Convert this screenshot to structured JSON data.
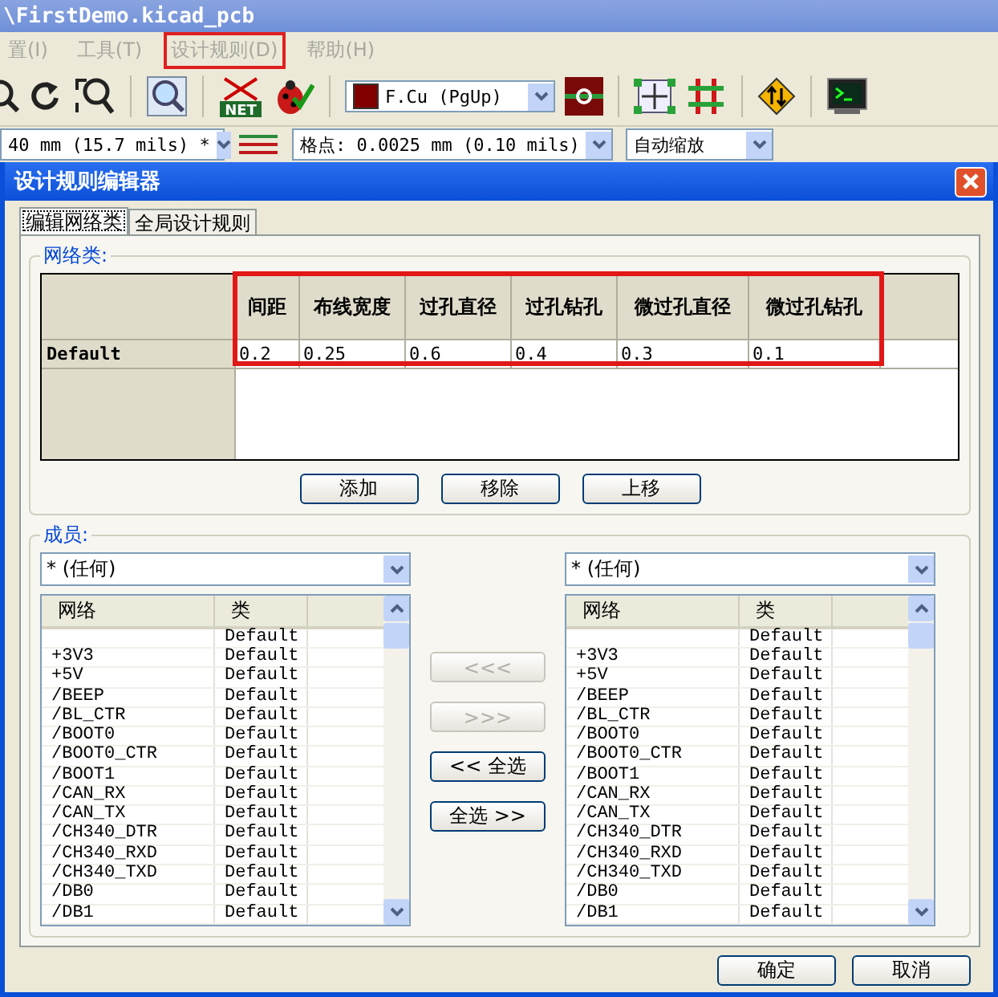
{
  "window": {
    "title": "\\FirstDemo.kicad_pcb"
  },
  "menu": [
    {
      "label": "置(I)",
      "highlighted": false
    },
    {
      "label": "工具(T)",
      "highlighted": false
    },
    {
      "label": "设计规则(D)",
      "highlighted": true
    },
    {
      "label": "帮助(H)",
      "highlighted": false
    }
  ],
  "toolbar": {
    "netlist_label": "NET",
    "layer": {
      "value": "F.Cu (PgUp)",
      "color": "#800000"
    }
  },
  "toolbar2": {
    "track_width": "40 mm (15.7 mils) *",
    "grid": "格点: 0.0025 mm (0.10 mils)",
    "zoom": "自动缩放"
  },
  "dialog": {
    "title": "设计规则编辑器",
    "tabs": [
      {
        "label": "编辑网络类",
        "selected": true
      },
      {
        "label": "全局设计规则",
        "selected": false
      }
    ],
    "net_classes": {
      "legend": "网络类:",
      "highlight_columns": true,
      "columns": [
        "间距",
        "布线宽度",
        "过孔直径",
        "过孔钻孔",
        "微过孔直径",
        "微过孔钻孔"
      ],
      "rows": [
        {
          "name": "Default",
          "cells": [
            "0.2",
            "0.25",
            "0.6",
            "0.4",
            "0.3",
            "0.1"
          ]
        }
      ],
      "buttons": [
        "添加",
        "移除",
        "上移"
      ]
    },
    "members": {
      "legend": "成员:",
      "panels": [
        {
          "filter": "* (任何)",
          "columns": [
            "网络",
            "类"
          ],
          "rows": [
            {
              "net": "",
              "class": "Default"
            },
            {
              "net": "+3V3",
              "class": "Default"
            },
            {
              "net": "+5V",
              "class": "Default"
            },
            {
              "net": "/BEEP",
              "class": "Default"
            },
            {
              "net": "/BL_CTR",
              "class": "Default"
            },
            {
              "net": "/BOOT0",
              "class": "Default"
            },
            {
              "net": "/BOOT0_CTR",
              "class": "Default"
            },
            {
              "net": "/BOOT1",
              "class": "Default"
            },
            {
              "net": "/CAN_RX",
              "class": "Default"
            },
            {
              "net": "/CAN_TX",
              "class": "Default"
            },
            {
              "net": "/CH340_DTR",
              "class": "Default"
            },
            {
              "net": "/CH340_RXD",
              "class": "Default"
            },
            {
              "net": "/CH340_TXD",
              "class": "Default"
            },
            {
              "net": "/DB0",
              "class": "Default"
            },
            {
              "net": "/DB1",
              "class": "Default"
            }
          ]
        },
        {
          "filter": "* (任何)",
          "columns": [
            "网络",
            "类"
          ],
          "rows": [
            {
              "net": "",
              "class": "Default"
            },
            {
              "net": "+3V3",
              "class": "Default"
            },
            {
              "net": "+5V",
              "class": "Default"
            },
            {
              "net": "/BEEP",
              "class": "Default"
            },
            {
              "net": "/BL_CTR",
              "class": "Default"
            },
            {
              "net": "/BOOT0",
              "class": "Default"
            },
            {
              "net": "/BOOT0_CTR",
              "class": "Default"
            },
            {
              "net": "/BOOT1",
              "class": "Default"
            },
            {
              "net": "/CAN_RX",
              "class": "Default"
            },
            {
              "net": "/CAN_TX",
              "class": "Default"
            },
            {
              "net": "/CH340_DTR",
              "class": "Default"
            },
            {
              "net": "/CH340_RXD",
              "class": "Default"
            },
            {
              "net": "/CH340_TXD",
              "class": "Default"
            },
            {
              "net": "/DB0",
              "class": "Default"
            },
            {
              "net": "/DB1",
              "class": "Default"
            }
          ]
        }
      ],
      "move_buttons": [
        {
          "label": "<<<",
          "disabled": true
        },
        {
          "label": ">>>",
          "disabled": true
        },
        {
          "label": "<< 全选",
          "disabled": false
        },
        {
          "label": "全选 >>",
          "disabled": false
        }
      ]
    },
    "buttons": [
      "确定",
      "取消"
    ]
  }
}
